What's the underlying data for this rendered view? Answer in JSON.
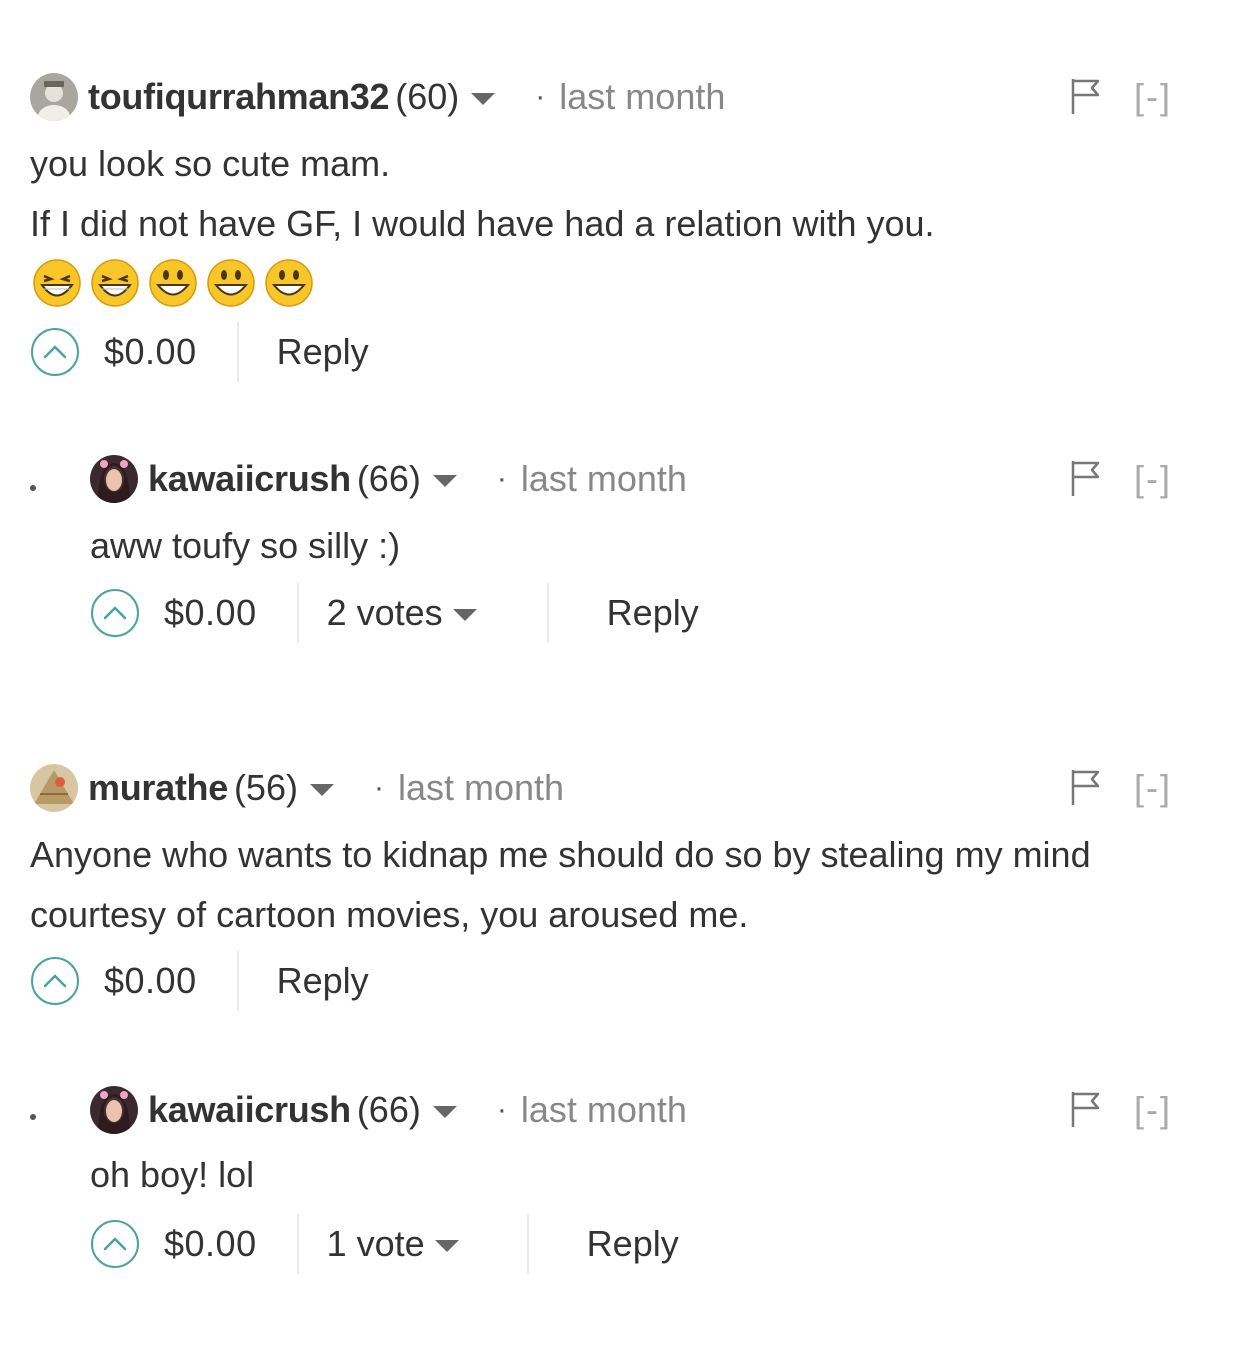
{
  "comments": [
    {
      "username": "toufiqurrahman32",
      "reputation": "(60)",
      "time": "last month",
      "collapse": "[-]",
      "body": [
        "you look so cute mam.",
        "If I did not have GF, I would have had a relation with you."
      ],
      "emojis": [
        "grinning-squinting-face",
        "grinning-squinting-face",
        "grinning-face",
        "grinning-face",
        "grinning-face"
      ],
      "payout": "$0.00",
      "reply": "Reply",
      "avatar_icon": "user-avatar-icon"
    },
    {
      "username": "kawaiicrush",
      "reputation": "(66)",
      "time": "last month",
      "collapse": "[-]",
      "body": [
        "aww toufy so silly :)"
      ],
      "payout": "$0.00",
      "votes": "2 votes",
      "reply": "Reply",
      "avatar_icon": "user-avatar-icon"
    },
    {
      "username": "murathe",
      "reputation": "(56)",
      "time": "last month",
      "collapse": "[-]",
      "body": [
        "Anyone who wants to kidnap me should do so by stealing my mind",
        "courtesy of cartoon movies, you aroused me."
      ],
      "payout": "$0.00",
      "reply": "Reply",
      "avatar_icon": "user-avatar-icon"
    },
    {
      "username": "kawaiicrush",
      "reputation": "(66)",
      "time": "last month",
      "collapse": "[-]",
      "body": [
        "oh boy! lol"
      ],
      "payout": "$0.00",
      "votes": "1 vote",
      "reply": "Reply",
      "avatar_icon": "user-avatar-icon"
    }
  ],
  "separator": "·",
  "icons": {
    "flag": "flag-icon",
    "upvote": "upvote-chevron-icon",
    "dropdown": "caret-down-icon"
  },
  "colors": {
    "upvote_accent": "#4ba2a0",
    "text": "#333333",
    "muted": "#888888",
    "collapse": "#aaaaaa"
  }
}
